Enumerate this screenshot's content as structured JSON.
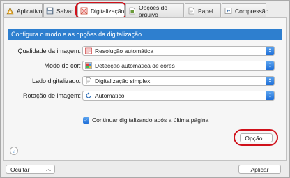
{
  "tabs": [
    {
      "label": "Aplicativo",
      "icon": "application-icon"
    },
    {
      "label": "Salvar",
      "icon": "save-icon"
    },
    {
      "label": "Digitalização",
      "icon": "scan-icon",
      "active": true
    },
    {
      "label": "Opções do arquivo",
      "icon": "file-options-icon"
    },
    {
      "label": "Papel",
      "icon": "paper-icon"
    },
    {
      "label": "Compressão",
      "icon": "compression-icon"
    }
  ],
  "banner": "Configura o modo e as opções da digitalização.",
  "fields": [
    {
      "label": "Qualidade da imagem:",
      "value": "Resolução automática",
      "icon": "resolution-icon"
    },
    {
      "label": "Modo de cor:",
      "value": "Detecção automática de cores",
      "icon": "color-mode-icon"
    },
    {
      "label": "Lado digitalizado:",
      "value": "Digitalização simplex",
      "icon": "simplex-page-icon"
    },
    {
      "label": "Rotação de imagem:",
      "value": "Automático",
      "icon": "rotation-icon"
    }
  ],
  "continue_checkbox": {
    "label": "Continuar digitalizando após a última página",
    "checked": true
  },
  "buttons": {
    "option": "Opção...",
    "hide": "Ocultar",
    "apply": "Aplicar",
    "help": "?"
  },
  "colors": {
    "accent": "#2e7fcf",
    "highlight": "#d0111b"
  }
}
